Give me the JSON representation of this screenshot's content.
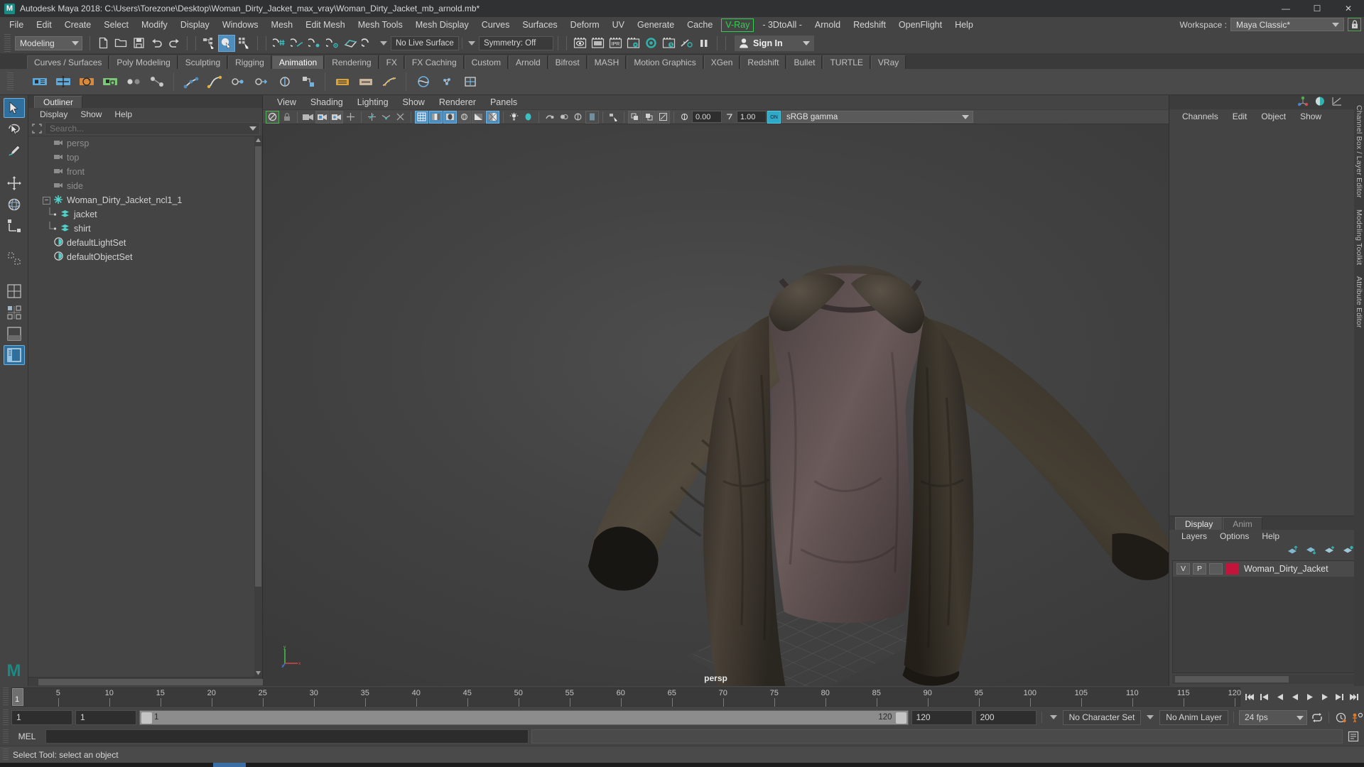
{
  "titlebar": {
    "app_icon": "maya-logo-icon",
    "title": "Autodesk Maya 2018: C:\\Users\\Torezone\\Desktop\\Woman_Dirty_Jacket_max_vray\\Woman_Dirty_Jacket_mb_arnold.mb*",
    "minimize": "—",
    "maximize": "☐",
    "close": "✕"
  },
  "menubar": {
    "items": [
      "File",
      "Edit",
      "Create",
      "Select",
      "Modify",
      "Display",
      "Windows",
      "Mesh",
      "Edit Mesh",
      "Mesh Tools",
      "Mesh Display",
      "Curves",
      "Surfaces",
      "Deform",
      "UV",
      "Generate",
      "Cache"
    ],
    "vray": "V-Ray",
    "items_after": [
      "- 3DtoAll -",
      "Arnold",
      "Redshift",
      "OpenFlight",
      "Help"
    ],
    "workspace_label": "Workspace :",
    "workspace_value": "Maya Classic*",
    "lock_icon": "lock-icon",
    "vray_color": "#2fd24f"
  },
  "statusbar": {
    "menu_set": "Modeling",
    "new_scene": "new-scene-icon",
    "open_scene": "open-scene-icon",
    "save_scene": "save-scene-icon",
    "undo": "undo-icon",
    "redo": "redo-icon",
    "select_hierarchy": "select-by-hierarchy-icon",
    "select_object": "select-by-object-type-icon",
    "select_component": "select-by-component-type-icon",
    "snap_grid": "snap-to-grid-icon",
    "snap_curve": "snap-to-curve-icon",
    "snap_point": "snap-to-point-icon",
    "snap_projected": "snap-to-projected-center-icon",
    "snap_view_plane": "snap-to-view-plane-icon",
    "make_live": "make-live-icon",
    "live_surface": "No Live Surface",
    "symmetry": "Symmetry: Off",
    "render_view": "render-view-icon",
    "render_region": "render-region-icon",
    "ipr": "IPR",
    "render_settings": "render-settings-icon",
    "hypershade": "hypershade-icon",
    "render_sequence": "render-sequence-icon",
    "toggle_history": "toggle-construction-history-icon",
    "pause": "pause-icon",
    "signin": "Sign In",
    "signin_icon": "user-avatar-icon"
  },
  "shelf": {
    "tabs": [
      "Curves / Surfaces",
      "Poly Modeling",
      "Sculpting",
      "Rigging",
      "Animation",
      "Rendering",
      "FX",
      "FX Caching",
      "Custom",
      "Arnold",
      "Bifrost",
      "MASH",
      "Motion Graphics",
      "XGen",
      "Redshift",
      "Bullet",
      "TURTLE",
      "VRay"
    ],
    "active_tab": "Animation",
    "icons": [
      "set-key-icon",
      "set-key-translate-icon",
      "set-key-rotate-icon",
      "set-key-scale-icon",
      "breakdown-key-icon",
      "set-driven-key-icon",
      "ik-handle-icon",
      "ik-spline-icon",
      "constraint-point-icon",
      "constraint-aim-icon",
      "constraint-orient-icon",
      "constraint-parent-icon",
      "ghost-selected-icon",
      "unghost-selected-icon",
      "motion-trail-icon",
      "create-deformer-icon",
      "create-cluster-icon",
      "create-lattice-icon"
    ]
  },
  "toolbox": {
    "items": [
      "select-tool-icon",
      "lasso-select-tool-icon",
      "paint-select-tool-icon",
      "move-tool-icon",
      "rotate-tool-icon",
      "scale-tool-icon",
      "last-tool-icon",
      "single-perspective-layout-icon",
      "four-view-layout-icon",
      "persp-outliner-layout-icon",
      "persp-graph-layout-icon",
      "hypershade-layout-icon"
    ],
    "active": "select-tool-icon",
    "active_layout": "persp-outliner-layout-icon",
    "brand_mark": "M"
  },
  "outliner": {
    "tab_label": "Outliner",
    "menus": [
      "Display",
      "Show",
      "Help"
    ],
    "search_placeholder": "Search...",
    "search_value": "",
    "items": [
      {
        "label": "persp",
        "icon": "camera-icon",
        "indent": 1,
        "dim": true,
        "expander": false
      },
      {
        "label": "top",
        "icon": "camera-icon",
        "indent": 1,
        "dim": true,
        "expander": false
      },
      {
        "label": "front",
        "icon": "camera-icon",
        "indent": 1,
        "dim": true,
        "expander": false
      },
      {
        "label": "side",
        "icon": "camera-icon",
        "indent": 1,
        "dim": true,
        "expander": false
      },
      {
        "label": "Woman_Dirty_Jacket_ncl1_1",
        "icon": "ncloth-icon",
        "indent": 0,
        "dim": false,
        "expander": true
      },
      {
        "label": "jacket",
        "icon": "mesh-icon",
        "indent": 2,
        "dim": false,
        "expander": false,
        "branch": "mid"
      },
      {
        "label": "shirt",
        "icon": "mesh-icon",
        "indent": 2,
        "dim": false,
        "expander": false,
        "branch": "last"
      },
      {
        "label": "defaultLightSet",
        "icon": "set-icon",
        "indent": 1,
        "dim": false,
        "expander": false
      },
      {
        "label": "defaultObjectSet",
        "icon": "set-icon",
        "indent": 1,
        "dim": false,
        "expander": false
      }
    ]
  },
  "viewport": {
    "menus": [
      "View",
      "Shading",
      "Lighting",
      "Show",
      "Renderer",
      "Panels"
    ],
    "camera_label": "persp",
    "exposure_value": "0.00",
    "gamma_value": "1.00",
    "color_profile": "sRGB gamma",
    "toolbar_icons": [
      "select-camera-icon",
      "lock-camera-icon",
      "camera-attributes-icon",
      "bookmark-icon",
      "image-plane-icon",
      "two-d-pan-zoom-icon",
      "grid-icon",
      "film-gate-icon",
      "resolution-gate-icon",
      "gate-mask-icon",
      "field-chart-icon",
      "safe-action-icon",
      "safe-title-icon",
      "wireframe-icon",
      "smooth-shade-all-icon",
      "smooth-shade-selected-icon",
      "flat-shade-icon",
      "shaded-wireframe-icon",
      "textured-icon",
      "use-default-light-icon",
      "use-all-lights-icon",
      "shadows-icon",
      "ambient-occlusion-icon",
      "motion-blur-icon",
      "multisample-icon",
      "xray-icon",
      "xray-joints-icon",
      "xray-active-icon",
      "isolate-select-icon",
      "exposure-icon",
      "gamma-icon",
      "color-management-icon"
    ],
    "render_subject": "woman-dirty-jacket-3d-model"
  },
  "channelbox": {
    "top_icons": [
      "show-manipulators-icon",
      "channel-box-icon",
      "graph-editor-icon"
    ],
    "menus": [
      "Channels",
      "Edit",
      "Object",
      "Show"
    ],
    "empty": ""
  },
  "layer_editor": {
    "tabs": [
      "Display",
      "Anim"
    ],
    "active_tab": "Display",
    "menus": [
      "Layers",
      "Options",
      "Help"
    ],
    "icons": [
      "move-layer-up-icon",
      "move-layer-down-icon",
      "new-layer-from-selected-icon",
      "new-layer-icon"
    ],
    "layers": [
      {
        "visibility": "V",
        "playback": "P",
        "type": "",
        "color": "#c4143c",
        "name": "Woman_Dirty_Jacket"
      }
    ]
  },
  "right_edge_tabs": [
    "Channel Box / Layer Editor",
    "Modeling Toolkit",
    "Attribute Editor"
  ],
  "timeslider": {
    "current_frame": "1",
    "ticks": [
      5,
      10,
      15,
      20,
      25,
      30,
      35,
      40,
      45,
      50,
      55,
      60,
      65,
      70,
      75,
      80,
      85,
      90,
      95,
      100,
      105,
      110,
      115,
      120
    ],
    "start": 1,
    "end": 120,
    "frame_field": "1",
    "playback_buttons": [
      "go-to-start-icon",
      "step-back-frame-icon",
      "step-back-key-icon",
      "play-backwards-icon",
      "play-forwards-icon",
      "step-forward-key-icon",
      "step-forward-frame-icon",
      "go-to-end-icon"
    ]
  },
  "rangeslider": {
    "anim_start": "1",
    "range_start": "1",
    "bar_start_label": "1",
    "bar_end_label": "120",
    "range_end": "120",
    "anim_end": "200",
    "character_set": "No Character Set",
    "anim_layer": "No Anim Layer",
    "fps": "24 fps",
    "loop_icon": "playback-loop-icon",
    "auto_key_icon": "auto-keyframe-icon",
    "anim_prefs_icon": "animation-preferences-icon"
  },
  "commandline": {
    "language": "MEL",
    "input_value": "",
    "output_value": "",
    "script_editor_icon": "script-editor-icon"
  },
  "helpline": {
    "text": "Select Tool: select an object"
  },
  "colors": {
    "accent_blue": "#4f8dbd",
    "teal": "#22b8b0",
    "green": "#2fd24f",
    "panel_bg": "#444444",
    "dark_bg": "#3c3c3c",
    "layer_red": "#c4143c"
  }
}
